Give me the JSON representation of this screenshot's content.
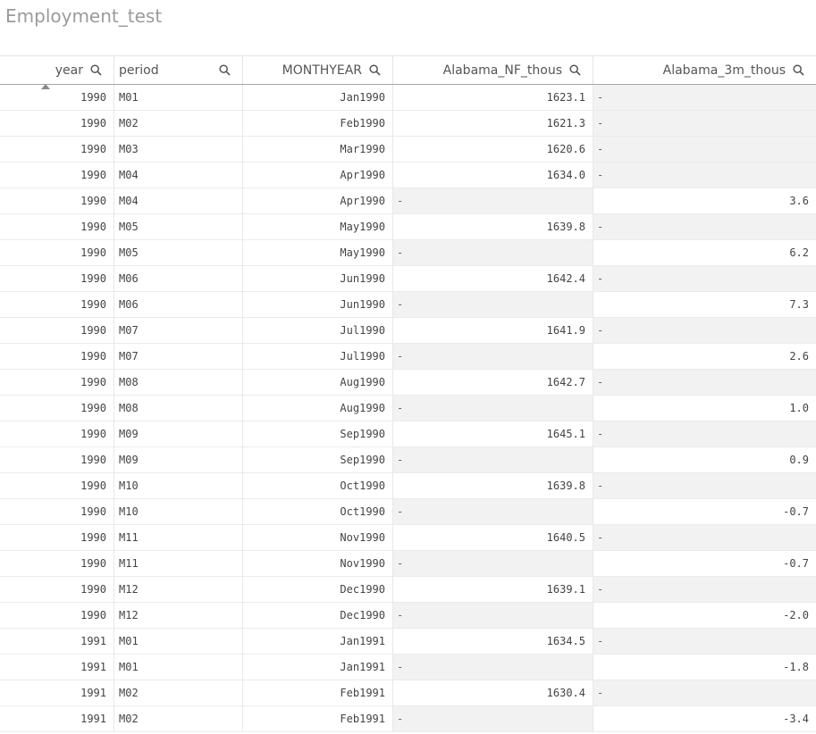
{
  "app": {
    "title": "Employment_test"
  },
  "table": {
    "columns": [
      {
        "label": "year",
        "align": "right"
      },
      {
        "label": "period",
        "align": "left"
      },
      {
        "label": "MONTHYEAR",
        "align": "right"
      },
      {
        "label": "Alabama_NF_thous",
        "align": "right"
      },
      {
        "label": "Alabama_3m_thous",
        "align": "right"
      }
    ],
    "null_symbol": "-",
    "rows": [
      [
        "1990",
        "M01",
        "Jan1990",
        "1623.1",
        "-"
      ],
      [
        "1990",
        "M02",
        "Feb1990",
        "1621.3",
        "-"
      ],
      [
        "1990",
        "M03",
        "Mar1990",
        "1620.6",
        "-"
      ],
      [
        "1990",
        "M04",
        "Apr1990",
        "1634.0",
        "-"
      ],
      [
        "1990",
        "M04",
        "Apr1990",
        "-",
        "3.6"
      ],
      [
        "1990",
        "M05",
        "May1990",
        "1639.8",
        "-"
      ],
      [
        "1990",
        "M05",
        "May1990",
        "-",
        "6.2"
      ],
      [
        "1990",
        "M06",
        "Jun1990",
        "1642.4",
        "-"
      ],
      [
        "1990",
        "M06",
        "Jun1990",
        "-",
        "7.3"
      ],
      [
        "1990",
        "M07",
        "Jul1990",
        "1641.9",
        "-"
      ],
      [
        "1990",
        "M07",
        "Jul1990",
        "-",
        "2.6"
      ],
      [
        "1990",
        "M08",
        "Aug1990",
        "1642.7",
        "-"
      ],
      [
        "1990",
        "M08",
        "Aug1990",
        "-",
        "1.0"
      ],
      [
        "1990",
        "M09",
        "Sep1990",
        "1645.1",
        "-"
      ],
      [
        "1990",
        "M09",
        "Sep1990",
        "-",
        "0.9"
      ],
      [
        "1990",
        "M10",
        "Oct1990",
        "1639.8",
        "-"
      ],
      [
        "1990",
        "M10",
        "Oct1990",
        "-",
        "-0.7"
      ],
      [
        "1990",
        "M11",
        "Nov1990",
        "1640.5",
        "-"
      ],
      [
        "1990",
        "M11",
        "Nov1990",
        "-",
        "-0.7"
      ],
      [
        "1990",
        "M12",
        "Dec1990",
        "1639.1",
        "-"
      ],
      [
        "1990",
        "M12",
        "Dec1990",
        "-",
        "-2.0"
      ],
      [
        "1991",
        "M01",
        "Jan1991",
        "1634.5",
        "-"
      ],
      [
        "1991",
        "M01",
        "Jan1991",
        "-",
        "-1.8"
      ],
      [
        "1991",
        "M02",
        "Feb1991",
        "1630.4",
        "-"
      ],
      [
        "1991",
        "M02",
        "Feb1991",
        "-",
        "-3.4"
      ]
    ]
  },
  "icons": {
    "column_search": "search-icon",
    "sort": "sort-ascending-icon"
  },
  "colors": {
    "title": "#9b9b9b",
    "null_bg": "#f2f2f2",
    "header_text": "#555555"
  }
}
